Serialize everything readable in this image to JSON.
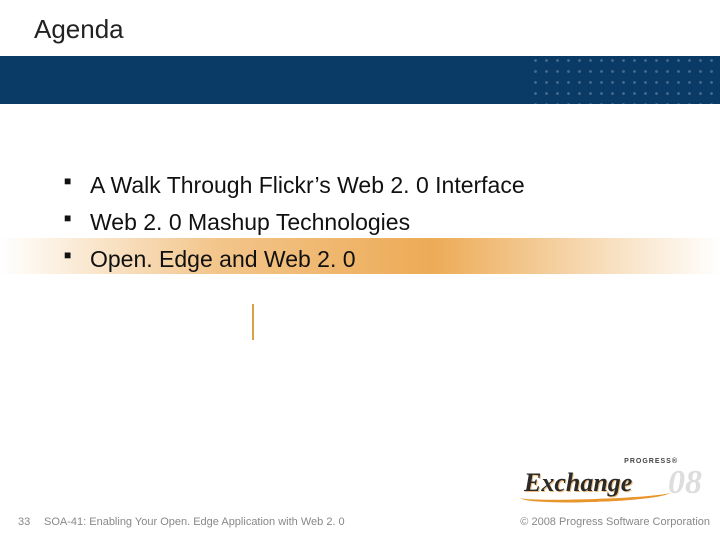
{
  "title": "Agenda",
  "bullets": [
    "A Walk Through Flickr’s Web 2. 0 Interface",
    "Web 2. 0 Mashup Technologies",
    "Open. Edge and Web 2. 0"
  ],
  "footer": {
    "page": "33",
    "session": "SOA-41: Enabling Your Open. Edge Application with Web 2. 0",
    "copyright": "© 2008 Progress Software Corporation"
  },
  "logo": {
    "tag": "PROGRESS®",
    "word": "Exchange",
    "year": "08"
  }
}
